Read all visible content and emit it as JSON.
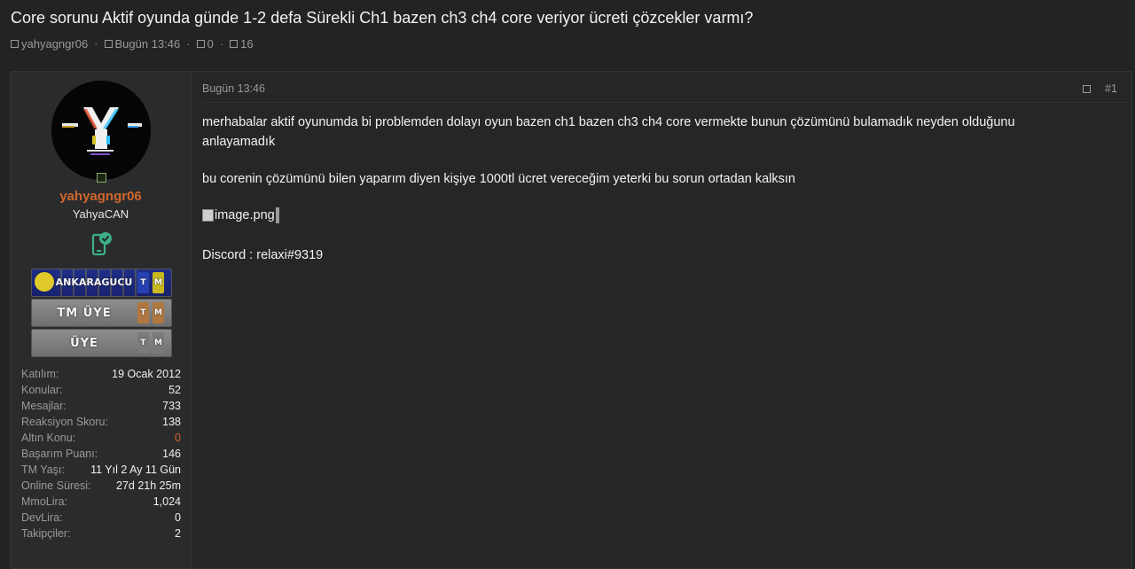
{
  "thread": {
    "title": "Core sorunu Aktif oyunda günde 1-2 defa Sürekli Ch1 bazen ch3 ch4 core veriyor ücreti çözcekler varmı?",
    "author": "yahyagngr06",
    "date": "Bugün 13:46",
    "replies": "0",
    "views": "16"
  },
  "user": {
    "name": "yahyagngr06",
    "title": "YahyaCAN",
    "banners": [
      {
        "text": "ANKARAGUCU",
        "tag1": "T",
        "tag2": "M"
      },
      {
        "text": "TM ÜYE",
        "tag1": "T",
        "tag2": "M"
      },
      {
        "text": "ÜYE",
        "tag1": "T",
        "tag2": "M"
      }
    ],
    "stats": [
      {
        "label": "Katılım:",
        "value": "19 Ocak 2012"
      },
      {
        "label": "Konular:",
        "value": "52"
      },
      {
        "label": "Mesajlar:",
        "value": "733"
      },
      {
        "label": "Reaksiyon Skoru:",
        "value": "138"
      },
      {
        "label": "Altın Konu:",
        "value": "0"
      },
      {
        "label": "Başarım Puanı:",
        "value": "146"
      },
      {
        "label": "TM Yaşı:",
        "value": "11 Yıl 2 Ay 11 Gün"
      },
      {
        "label": "Online Süresi:",
        "value": "27d 21h 25m"
      },
      {
        "label": "MmoLira:",
        "value": "1,024"
      },
      {
        "label": "DevLira:",
        "value": "0"
      },
      {
        "label": "Takipçiler:",
        "value": "2"
      }
    ]
  },
  "post": {
    "date": "Bugün 13:46",
    "number": "#1",
    "paragraph1": "merhabalar aktif oyunumda bi problemden dolayı oyun bazen ch1 bazen ch3 ch4 core vermekte bunun çözümünü bulamadık neyden olduğunu anlayamadık",
    "paragraph2": "bu corenin çözümünü bilen yaparım diyen kişiye 1000tl ücret vereceğim yeterki bu sorun ortadan kalksın",
    "image_alt": "image.png",
    "discord": "Discord : relaxi#9319"
  },
  "colors": {
    "background": "#222324",
    "username": "#d0662c",
    "muted": "#9a9a9a"
  },
  "icons": {
    "meta": "square-icon",
    "online": "online-status-icon",
    "verify": "phone-check-icon",
    "share": "share-icon"
  }
}
